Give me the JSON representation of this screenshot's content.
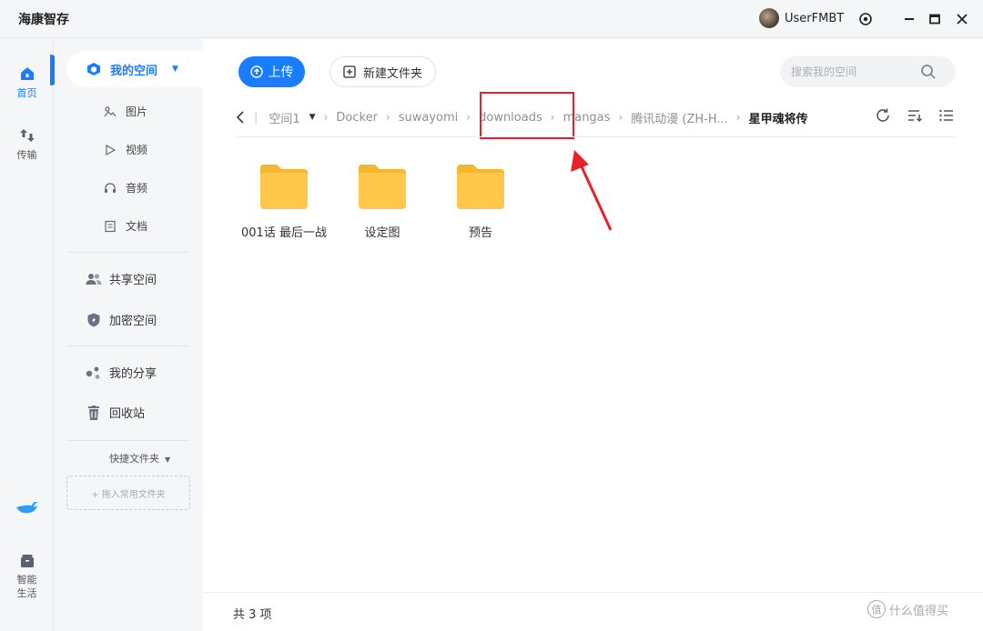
{
  "app": {
    "title": "海康智存"
  },
  "user": {
    "name": "UserFMBT"
  },
  "rail": {
    "home": "首页",
    "transfer": "传输",
    "smart_life": "智能\n生活"
  },
  "sidebar": {
    "my_space": "我的空间",
    "sub_items": [
      "图片",
      "视频",
      "音频",
      "文档"
    ],
    "shared_space": "共享空间",
    "encrypted_space": "加密空间",
    "my_share": "我的分享",
    "recycle_bin": "回收站",
    "quick_folders": "快捷文件夹",
    "drop_hint": "+ 拖入常用文件夹"
  },
  "toolbar": {
    "upload": "上传",
    "new_folder": "新建文件夹",
    "search_placeholder": "搜索我的空间"
  },
  "breadcrumb": {
    "root": "空间1",
    "items": [
      "Docker",
      "suwayomi",
      "downloads",
      "mangas",
      "腾讯动漫 (ZH-H..."
    ],
    "current": "星甲魂将传"
  },
  "files": [
    {
      "name": "001话 最后一战"
    },
    {
      "name": "设定图"
    },
    {
      "name": "预告"
    }
  ],
  "footer": {
    "count": "共 3 项"
  },
  "watermark": {
    "badge": "值",
    "text": "什么值得买"
  },
  "colors": {
    "accent": "#1a7cff",
    "folder": "#ffc84a",
    "highlight": "#e8202a"
  }
}
